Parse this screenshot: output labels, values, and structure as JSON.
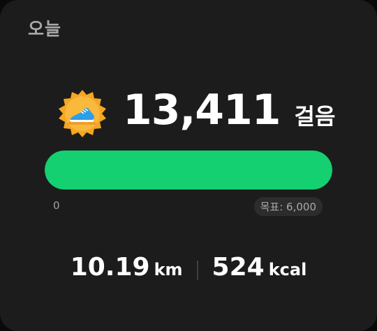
{
  "card": {
    "title": "오늘"
  },
  "badge": {
    "icon": "running-shoe-badge-icon"
  },
  "steps": {
    "value": "13,411",
    "unit": "걸음"
  },
  "progress": {
    "fraction": 1.0,
    "min_label": "0",
    "goal_label": "목표: 6,000"
  },
  "stats": {
    "distance": {
      "value": "10.19",
      "unit": "km"
    },
    "calories": {
      "value": "524",
      "unit": "kcal"
    }
  },
  "colors": {
    "accent": "#14d070",
    "card_bg": "#1c1c1c",
    "badge": "#f5a623"
  }
}
